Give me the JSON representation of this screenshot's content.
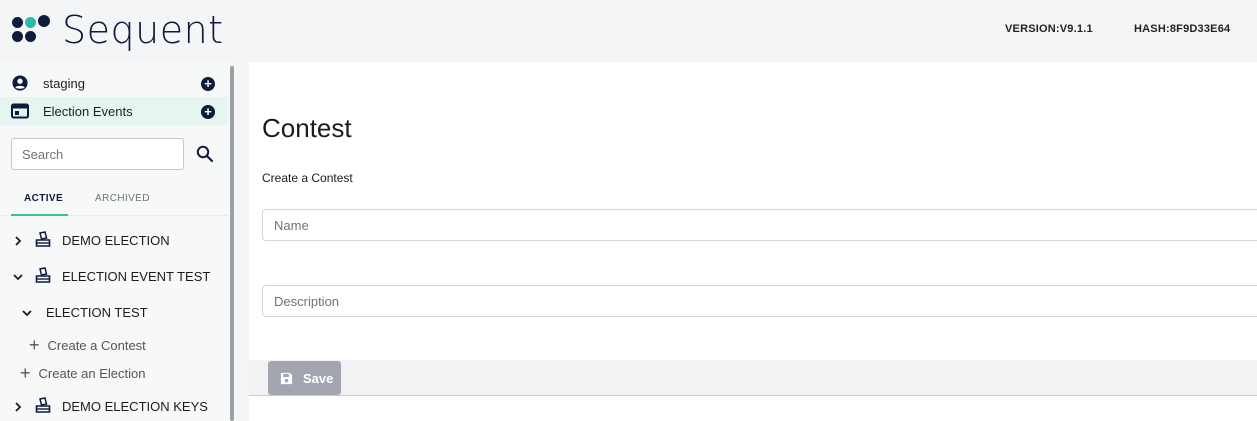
{
  "header": {
    "brand": "Sequent",
    "version": "VERSION:V9.1.1",
    "hash": "HASH:8F9D33E64"
  },
  "sidebar": {
    "tenant": {
      "label": "staging",
      "icon": "account-circle-icon"
    },
    "section": {
      "label": "Election Events",
      "icon": "election-events-icon"
    },
    "search": {
      "placeholder": "Search"
    },
    "tabs": [
      {
        "label": "ACTIVE",
        "selected": true
      },
      {
        "label": "ARCHIVED",
        "selected": false
      }
    ],
    "tree": [
      {
        "label": "DEMO ELECTION",
        "expanded": false
      },
      {
        "label": "ELECTION EVENT TEST",
        "expanded": true,
        "children": [
          {
            "label": "ELECTION TEST",
            "expanded": true
          },
          {
            "label": "Create a Contest"
          },
          {
            "label": "Create an Election"
          }
        ]
      },
      {
        "label": "DEMO ELECTION KEYS",
        "expanded": false
      }
    ]
  },
  "main": {
    "title": "Contest",
    "subtitle": "Create a Contest",
    "fields": {
      "name": {
        "placeholder": "Name",
        "value": ""
      },
      "description": {
        "placeholder": "Description",
        "value": ""
      }
    },
    "save_label": "Save"
  },
  "colors": {
    "brand_navy": "#0d1b3d",
    "accent_green": "#3fbf8e",
    "logo_teal": "#2fb8a6",
    "save_disabled": "#a3a5b1"
  }
}
